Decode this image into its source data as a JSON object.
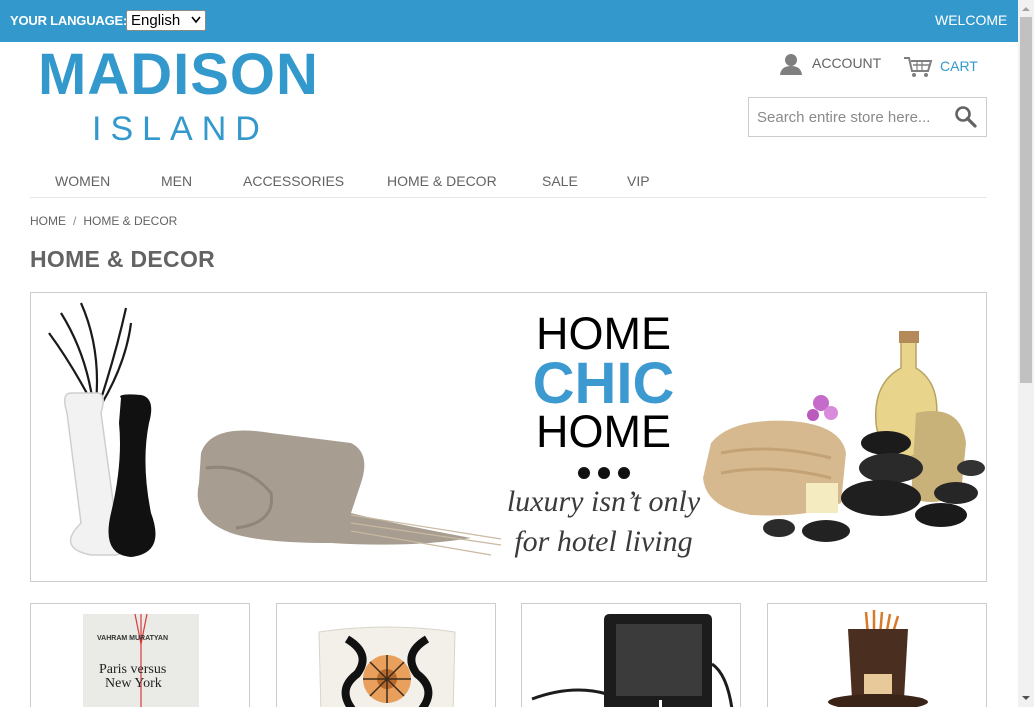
{
  "topbar": {
    "language_label": "YOUR LANGUAGE:",
    "language_value": "English",
    "welcome": "WELCOME"
  },
  "logo": {
    "main": "MADISON",
    "sub": "ISLAND"
  },
  "header": {
    "account_label": "ACCOUNT",
    "cart_label": "CART",
    "search_placeholder": "Search entire store here..."
  },
  "nav": {
    "items": [
      "WOMEN",
      "MEN",
      "ACCESSORIES",
      "HOME & DECOR",
      "SALE",
      "VIP"
    ]
  },
  "breadcrumb": {
    "items": [
      "HOME",
      "HOME & DECOR"
    ],
    "separator": "/"
  },
  "page": {
    "title": "HOME & DECOR"
  },
  "banner": {
    "line1": "HOME",
    "line2": "CHIC",
    "line3": "HOME",
    "tagline1": "luxury isn’t only",
    "tagline2": "for hotel living"
  },
  "products": {
    "book": {
      "author": "VAHRAM MURATYAN",
      "title_line1": "Paris versus",
      "title_line2": "New York"
    }
  },
  "colors": {
    "accent": "#3399cc",
    "text": "#636363",
    "border": "#cccccc"
  },
  "icons": {
    "account": "user-icon",
    "cart": "cart-icon",
    "search": "search-icon"
  }
}
